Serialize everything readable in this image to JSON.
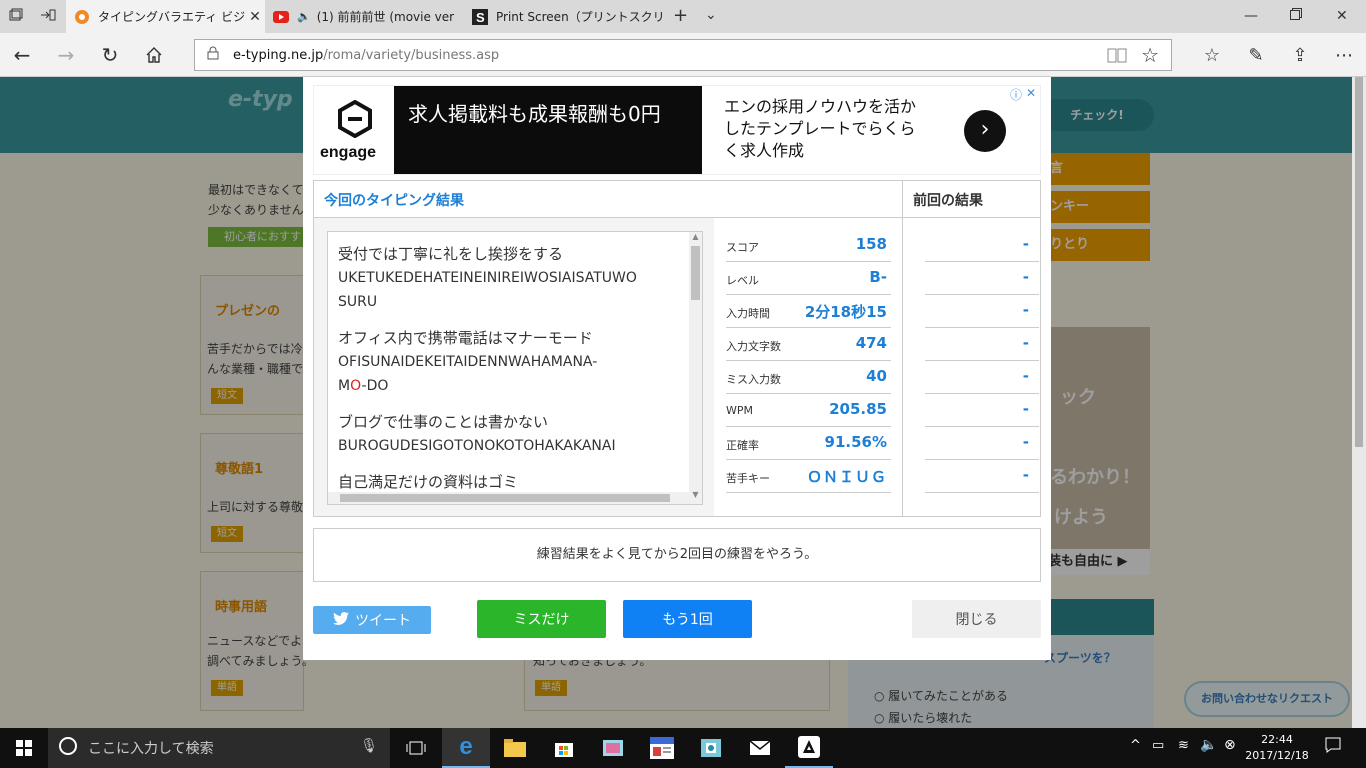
{
  "browser": {
    "tabs": [
      {
        "title": "タイピングバラエティ ビジネス",
        "active": true
      },
      {
        "title": "(1) 前前前世 (movie ver",
        "active": false
      },
      {
        "title": "Print Screen（プリントスクリー",
        "active": false
      }
    ],
    "address_domain": "e-typing.ne.jp",
    "address_path": "/roma/variety/business.asp"
  },
  "ad": {
    "brand": "engage",
    "headline": "求人掲載料も成果報酬も0円",
    "subtext": "エンの採用ノウハウを活かしたテンプレートでらくらく求人作成"
  },
  "results": {
    "current_title": "今回のタイピング結果",
    "previous_title": "前回の結果",
    "sentences": [
      {
        "jp": "受付では丁寧に礼をし挨拶をする",
        "roma_lines": [
          [
            "UKETUKEDEHATEINEINIREIWOSIAISATUWO"
          ],
          [
            "SURU"
          ]
        ]
      },
      {
        "jp": "オフィス内で携帯電話はマナーモード",
        "roma_lines": [
          [
            "OFISUNAIDEKEITAIDENNWAHAMANA-"
          ],
          [
            "M",
            "O",
            "-DO"
          ]
        ]
      },
      {
        "jp": "ブログで仕事のことは書かない",
        "roma_lines": [
          [
            "BUROGUDESIGOTONOKOTOHAKAKANAI"
          ]
        ]
      },
      {
        "jp": "自己満足だけの資料はゴミ",
        "roma_lines": []
      }
    ],
    "stats": [
      {
        "label": "スコア",
        "value": "158",
        "prev": "-"
      },
      {
        "label": "レベル",
        "value": "B-",
        "prev": "-"
      },
      {
        "label": "入力時間",
        "value": "2分18秒15",
        "prev": "-"
      },
      {
        "label": "入力文字数",
        "value": "474",
        "prev": "-"
      },
      {
        "label": "ミス入力数",
        "value": "40",
        "prev": "-"
      },
      {
        "label": "WPM",
        "value": "205.85",
        "prev": "-"
      },
      {
        "label": "正確率",
        "value": "91.56%",
        "prev": "-"
      },
      {
        "label": "苦手キー",
        "value": "ＯＮＩＵＧ",
        "prev": "-"
      }
    ]
  },
  "message": "練習結果をよく見てから2回目の練習をやろう。",
  "buttons": {
    "tweet": "ツイート",
    "miss_only": "ミスだけ",
    "retry": "もう1回",
    "close": "閉じる"
  },
  "colors": {
    "tweet": "#55acee",
    "miss_only": "#2ab52a",
    "retry": "#1080f5",
    "close_bg": "#efefef",
    "accent_blue": "#1d7fd6",
    "miss_red": "#e02020"
  },
  "background_page": {
    "sections": [
      {
        "title": "プレゼンの",
        "desc1": "苦手だからでは冷",
        "desc2": "んな業種・職種で",
        "tag": "短文"
      },
      {
        "title": "尊敬語1",
        "desc1": "上司に対する尊敬",
        "desc2": "",
        "tag": "短文"
      },
      {
        "title": "時事用語",
        "desc1": "ニュースなどでよ",
        "desc2": "調べてみましょう。",
        "tag": "単語"
      }
    ],
    "top_text1": "最初はできなくて",
    "top_text2": "少なくありません",
    "beginner_link": "初心者におすす",
    "right_menu": [
      "言",
      "ンキー",
      "りとり"
    ],
    "check_button": "チェック!",
    "right_ad_lines": [
      "ック",
      "るわかり！",
      "けよう",
      "装も自由に"
    ],
    "survey_title": "スプーツを？",
    "survey_options": [
      "履いてみたことがある",
      "履いたら壊れた"
    ],
    "inquiry_button": "お問い合わせなリクエスト",
    "mid_text": "知っておきましょう。",
    "mid_tag": "単語"
  },
  "taskbar": {
    "search_placeholder": "ここに入力して検索",
    "time": "22:44",
    "date": "2017/12/18"
  }
}
